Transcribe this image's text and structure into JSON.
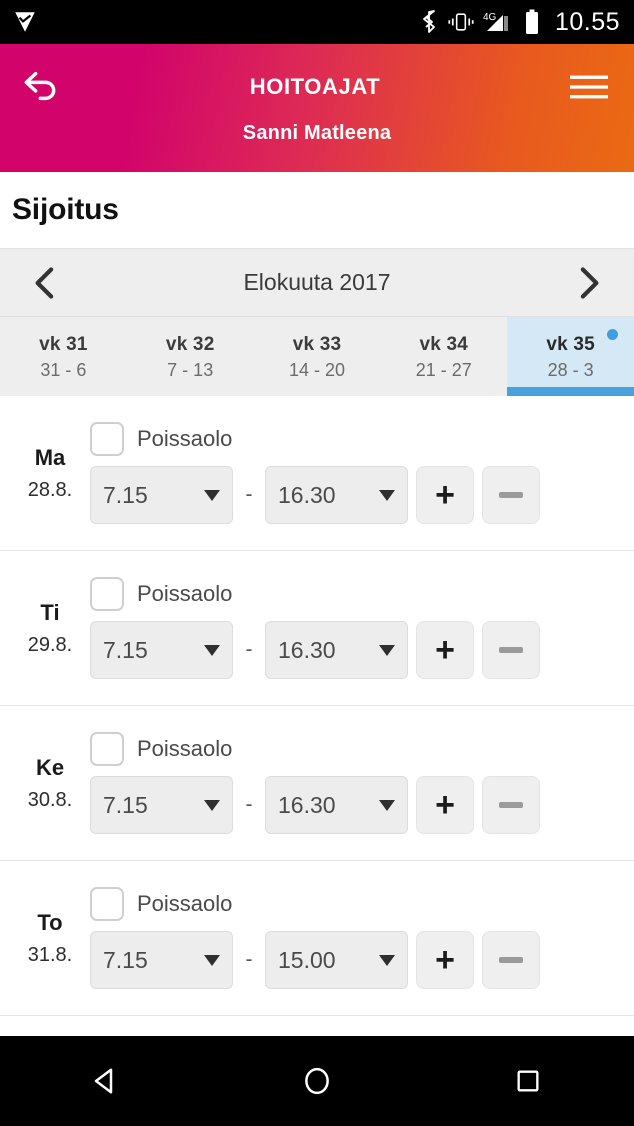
{
  "status_bar": {
    "app_icon": "checkmark-app-icon",
    "bluetooth_icon": "bluetooth-icon",
    "vibrate_icon": "vibrate-icon",
    "network_icon": "4g-signal-icon",
    "network_label": "4G",
    "battery_icon": "battery-icon",
    "time": "10.55"
  },
  "app_bar": {
    "back_icon": "back-arrow-icon",
    "title": "HOITOAJAT",
    "subtitle": "Sanni Matleena",
    "menu_icon": "hamburger-menu-icon",
    "gradient_start": "#d2046b",
    "gradient_end": "#ea6a13"
  },
  "page": {
    "title": "Sijoitus"
  },
  "month_nav": {
    "prev_icon": "chevron-left-icon",
    "next_icon": "chevron-right-icon",
    "label": "Elokuuta 2017"
  },
  "week_tabs": {
    "accent_color": "#4aa0da",
    "active_bg": "#d4e8f5",
    "items": [
      {
        "week": "vk 31",
        "range": "31 - 6",
        "active": false,
        "dot": false
      },
      {
        "week": "vk 32",
        "range": "7 - 13",
        "active": false,
        "dot": false
      },
      {
        "week": "vk 33",
        "range": "14 - 20",
        "active": false,
        "dot": false
      },
      {
        "week": "vk 34",
        "range": "21 - 27",
        "active": false,
        "dot": false
      },
      {
        "week": "vk 35",
        "range": "28 - 3",
        "active": true,
        "dot": true
      }
    ]
  },
  "days": [
    {
      "name": "Ma",
      "date": "28.8.",
      "absence_label": "Poissaolo",
      "absence_checked": false,
      "start_time": "7.15",
      "end_time": "16.30",
      "separator": "-",
      "add_label": "+",
      "remove_icon": "minus-icon",
      "add_enabled": true,
      "remove_enabled": false
    },
    {
      "name": "Ti",
      "date": "29.8.",
      "absence_label": "Poissaolo",
      "absence_checked": false,
      "start_time": "7.15",
      "end_time": "16.30",
      "separator": "-",
      "add_label": "+",
      "remove_icon": "minus-icon",
      "add_enabled": true,
      "remove_enabled": false
    },
    {
      "name": "Ke",
      "date": "30.8.",
      "absence_label": "Poissaolo",
      "absence_checked": false,
      "start_time": "7.15",
      "end_time": "16.30",
      "separator": "-",
      "add_label": "+",
      "remove_icon": "minus-icon",
      "add_enabled": true,
      "remove_enabled": false
    },
    {
      "name": "To",
      "date": "31.8.",
      "absence_label": "Poissaolo",
      "absence_checked": false,
      "start_time": "7.15",
      "end_time": "15.00",
      "separator": "-",
      "add_label": "+",
      "remove_icon": "minus-icon",
      "add_enabled": true,
      "remove_enabled": false
    }
  ],
  "nav_bar": {
    "back_icon": "android-back-icon",
    "home_icon": "android-home-icon",
    "recents_icon": "android-recents-icon"
  }
}
